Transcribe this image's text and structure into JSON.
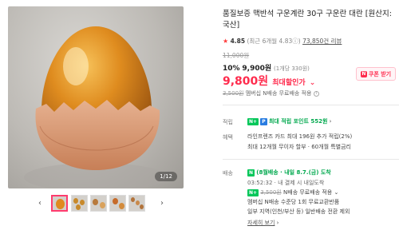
{
  "gallery": {
    "counter": "1/12",
    "prev_arrow": "‹",
    "next_arrow": "›",
    "thumb_count": 5
  },
  "product": {
    "title": "품질보증 맥반석 구운계란 30구 구운란 대란 [원산지:국산]",
    "rating": {
      "star": "★",
      "score": "4.85",
      "recent": "(최근 6개월 4.83",
      "recent_icon": "ⓘ",
      "recent_close": ")",
      "reviews": "73,850건 리뷰"
    },
    "original_price": "11,000원",
    "discount": {
      "percent": "10%",
      "price": "9,900원",
      "unit_price": "(1개당 330원)"
    },
    "max_discount": {
      "price": "9,800원",
      "label": "최대할인가",
      "chevron": "⌄"
    },
    "coupon": {
      "badge": "N",
      "label": "쿠폰 받기"
    },
    "shipping_summary": {
      "struck": "3,500원",
      "text": "멤버십 N배송 무료배송 적용"
    }
  },
  "benefits": {
    "points": {
      "label": "적립",
      "badge": "N+",
      "badge2": "P",
      "text": "최대 적립 포인트 552원",
      "chevron": "›"
    },
    "card": {
      "label": "혜택",
      "line1": "라인프렌즈 카드 최대 196원 추가 적립(2%)",
      "line2": "최대 12개월 무이자 할부 · 60개월 특별금리"
    }
  },
  "delivery": {
    "label": "배송",
    "badge": "N",
    "arrival": "(8월배송 · 내일 8.7.(금) 도착",
    "order_by": "03:52:32 · 내 결제 시 내일도착",
    "fee_badge": "N+",
    "fee_struck": "3,500원",
    "fee_text": "N배송 무료배송 적용",
    "fee_chevron": "⌄",
    "member_text": "멤버십 N배송 수준당 1회 무료교환반품",
    "return_text": "일부 지역(인천/부산 등) 일반배송 전환 제외",
    "detail_link": "자세히 보기",
    "detail_chevron": "›"
  }
}
